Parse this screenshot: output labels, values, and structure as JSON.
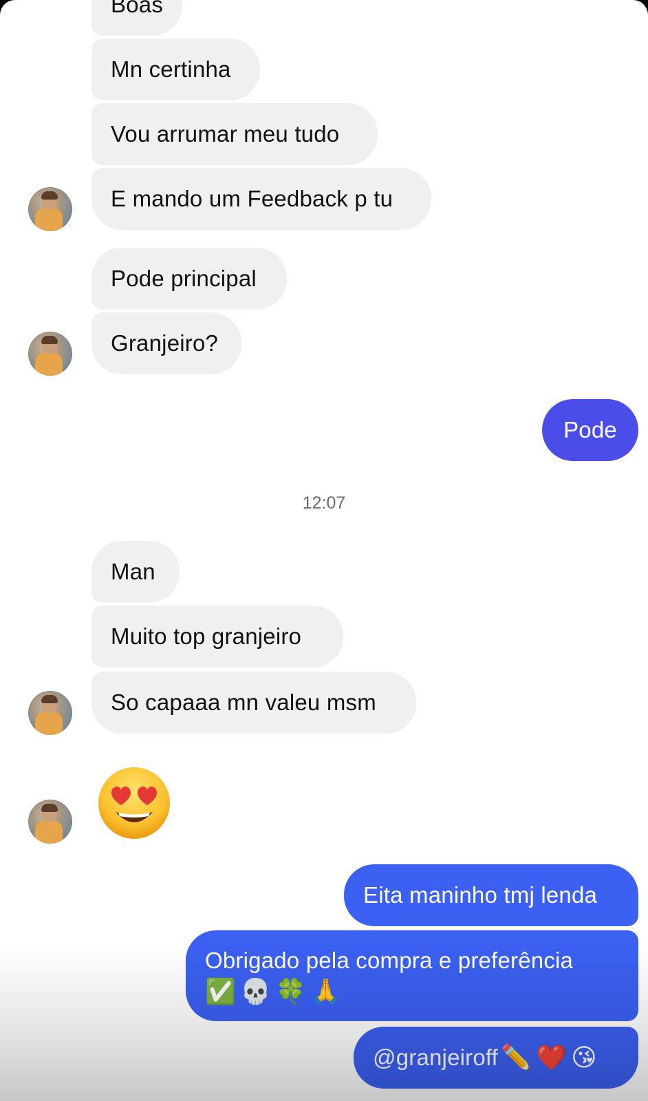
{
  "conversation": {
    "messages_in_block1": [
      "Boas",
      "Mn certinha",
      "Vou arrumar meu tudo",
      "E mando um Feedback p tu"
    ],
    "messages_in_block2": [
      "Pode principal",
      "Granjeiro?"
    ],
    "reply_pode": "Pode",
    "timestamp": "12:07",
    "messages_in_block3": [
      "Man",
      "Muito top granjeiro",
      "So capaaa mn valeu msm"
    ],
    "emoji_message": "heart-eyes-emoji",
    "outgoing_block": {
      "line1": "Eita maninho tmj lenda",
      "line2_text": "Obrigado pela compra e preferência",
      "line2_emojis": [
        "✅",
        "💀",
        "🍀",
        "🙏"
      ],
      "line3_handle": "@granjeiroff",
      "line3_emojis": [
        "✏️",
        "❤️",
        "😘"
      ]
    }
  },
  "colors": {
    "incoming_bubble": "#f0f0f2",
    "outgoing_bubble": "#3b60f2",
    "outgoing_solo_bubble": "#4b4de8"
  }
}
